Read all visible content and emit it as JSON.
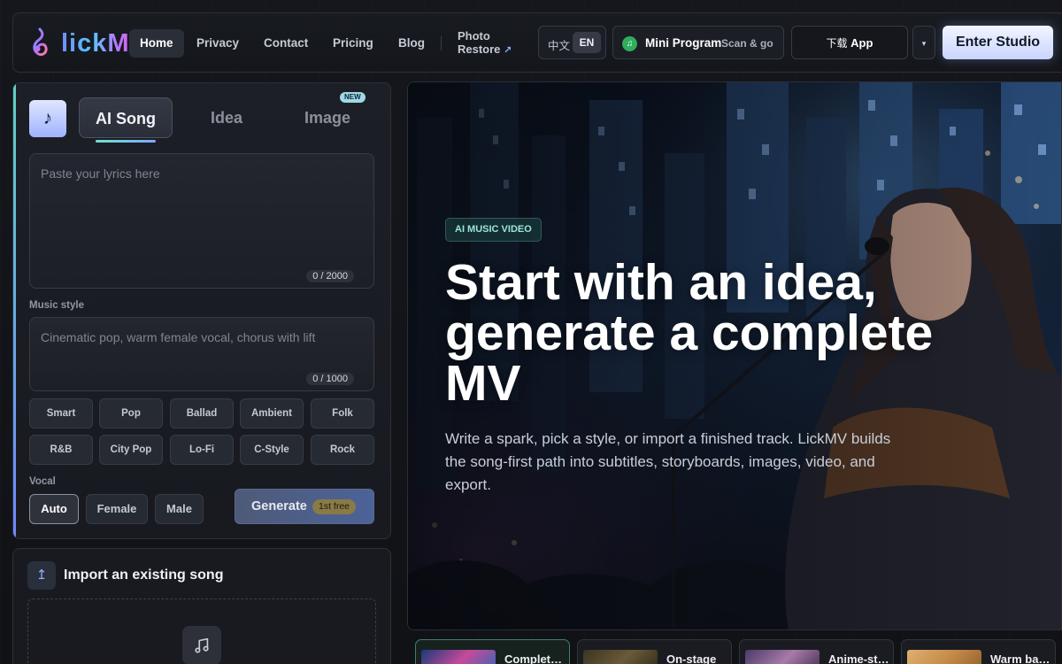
{
  "header": {
    "logo_text": "lickMV",
    "nav": [
      {
        "label": "Home",
        "active": true
      },
      {
        "label": "Privacy"
      },
      {
        "label": "Contact"
      },
      {
        "label": "Pricing"
      },
      {
        "label": "Blog"
      }
    ],
    "photo_restore_line1": "Photo",
    "photo_restore_line2": "Restore",
    "photo_restore_arrow": "↗",
    "lang_zh": "中文",
    "lang_en": "EN",
    "mini_program_label": "Mini Program",
    "mini_program_sub": "Scan & go",
    "download_zh": "下载",
    "download_label": "App",
    "dropdown_glyph": "▾",
    "studio_label": "Enter Studio"
  },
  "create": {
    "note_icon": "♪",
    "tabs": [
      {
        "label": "AI Song",
        "active": true
      },
      {
        "label": "Idea"
      },
      {
        "label": "Image",
        "badge": "NEW"
      }
    ],
    "lyrics_placeholder": "Paste your lyrics here",
    "lyrics_counter": "0 / 2000",
    "style_label": "Music style",
    "style_placeholder": "Cinematic pop, warm female vocal, chorus with lift",
    "style_counter": "0 / 1000",
    "styles": [
      "Smart",
      "Pop",
      "Ballad",
      "Ambient",
      "Folk",
      "R&B",
      "City Pop",
      "Lo-Fi",
      "C-Style",
      "Rock"
    ],
    "vocal_label": "Vocal",
    "vocals": [
      {
        "label": "Auto",
        "active": true
      },
      {
        "label": "Female"
      },
      {
        "label": "Male"
      }
    ],
    "generate_label": "Generate",
    "generate_badge": "1st free"
  },
  "import": {
    "icon": "↥",
    "title": "Import an existing song"
  },
  "hero": {
    "tag": "AI MUSIC VIDEO",
    "title": "Start with an idea, generate a complete MV",
    "subtitle": "Write a spark, pick a style, or import a finished track. LickMV builds the song-first path into subtitles, storyboards, images, video, and export."
  },
  "thumbnails": [
    {
      "label": "Complete MV",
      "active": true
    },
    {
      "label": "On-stage"
    },
    {
      "label": "Anime-style"
    },
    {
      "label": "Warm ballad"
    }
  ],
  "colors": {
    "accent_teal": "#6fe3cf",
    "accent_blue": "#7fa7ff",
    "studio_button": "#dfe6ff",
    "background": "#111318"
  }
}
